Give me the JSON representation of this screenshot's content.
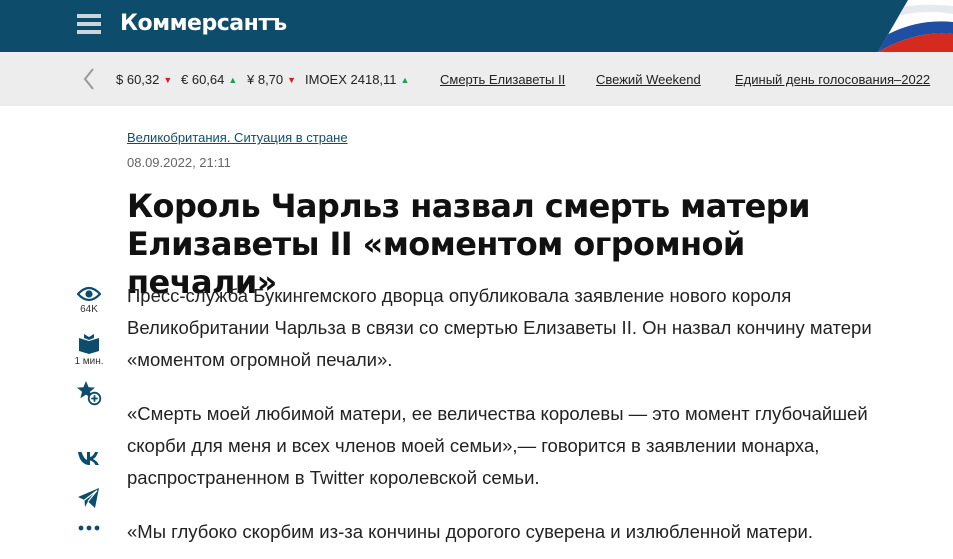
{
  "header": {
    "logo": "Коммерсантъ",
    "menu_icon": "hamburger-menu-icon",
    "flag_colors": [
      "#ffffff",
      "#1f4fa3",
      "#d52b1e"
    ]
  },
  "ticker": {
    "quotes": [
      {
        "label": "$ 60,32",
        "trend": "▼"
      },
      {
        "label": "€ 60,64",
        "trend": "▲"
      },
      {
        "label": "¥ 8,70",
        "trend": "▼"
      },
      {
        "label": "IMOEX 2418,11",
        "trend": "▲"
      }
    ],
    "links": [
      "Смерть Елизаветы II",
      "Свежий Weekend",
      "Единый день голосования–2022"
    ]
  },
  "article": {
    "rubric": "Великобритания. Ситуация в стране",
    "date": "08.09.2022, 21:11",
    "title": "Король Чарльз назвал смерть матери Елизаветы II «моментом огромной печали»",
    "paragraphs": [
      "Пресс-служба Букингемского дворца опубликовала заявление нового короля Великобритании Чарльза в связи со смертью Елизаветы II. Он назвал кончину матери «моментом огромной печали».",
      "«Смерть моей любимой матери, ее величества королевы — это момент глубочайшей скорби для меня и всех членов моей семьи»,— говорится в заявлении монарха, распространенном в Twitter королевской семьи.",
      "«Мы глубоко скорбим из-за кончины дорогого суверена и излюбленной матери."
    ]
  },
  "sidebar": {
    "views": "64K",
    "read_time": "1 мин."
  },
  "colors": {
    "header_bg": "#0d4d6b",
    "ticker_bg": "#ededed",
    "link": "#0f4f6e",
    "trend_down": "#d21f1f",
    "trend_up": "#1ea04a"
  }
}
